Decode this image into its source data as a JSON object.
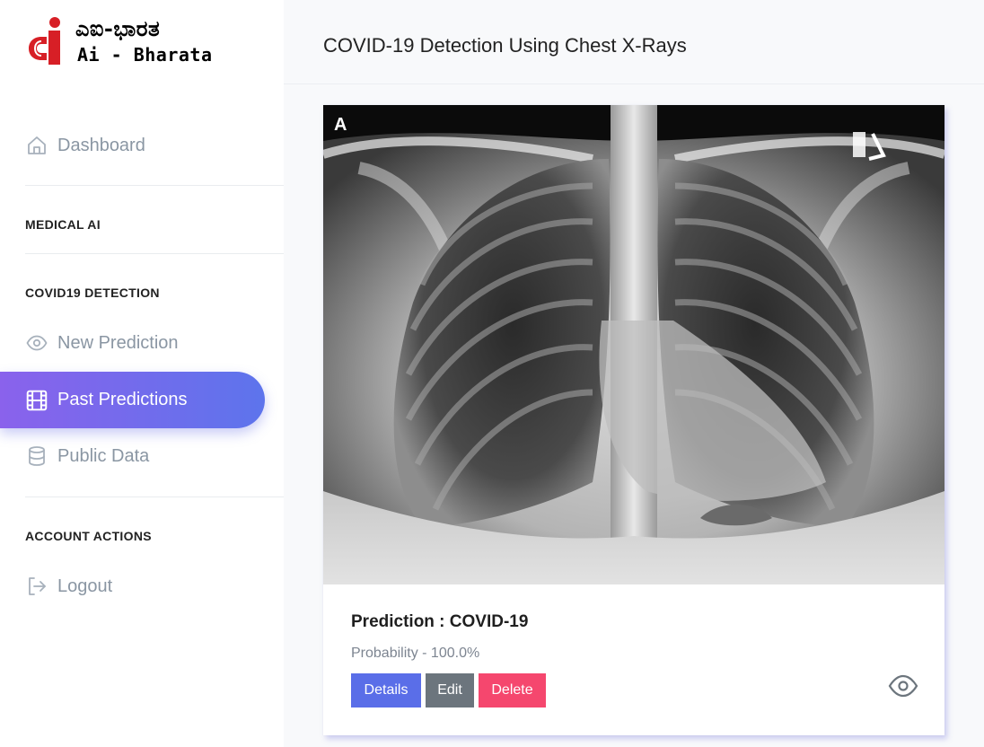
{
  "brand": {
    "script_text": "ಎಐ-ಭಾರತ",
    "latin_text": "Ai - Bharata",
    "colors": {
      "mark": "#d71f26",
      "text": "#000000"
    }
  },
  "sidebar": {
    "dashboard": {
      "label": "Dashboard",
      "icon": "home-icon"
    },
    "sections": [
      {
        "label": "MEDICAL AI"
      },
      {
        "label": "COVID19 DETECTION"
      },
      {
        "label": "ACCOUNT ACTIONS"
      }
    ],
    "items": [
      {
        "label": "New Prediction",
        "icon": "eye-icon"
      },
      {
        "label": "Past Predictions",
        "icon": "film-icon",
        "active": true
      },
      {
        "label": "Public Data",
        "icon": "database-icon"
      },
      {
        "label": "Logout",
        "icon": "logout-icon"
      }
    ]
  },
  "header": {
    "title": "COVID-19 Detection Using Chest X-Rays"
  },
  "card": {
    "image_label": "A",
    "prediction_title": "Prediction : COVID-19",
    "probability_text": "Probability - 100.0%",
    "buttons": {
      "details": "Details",
      "edit": "Edit",
      "delete": "Delete"
    },
    "view_icon": "eye-icon"
  },
  "colors": {
    "active_gradient_start": "#8a62ec",
    "active_gradient_end": "#5d74ec",
    "details": "#5a6ee8",
    "edit": "#6c757d",
    "delete": "#f5476e",
    "muted_text": "#8a96a3"
  }
}
